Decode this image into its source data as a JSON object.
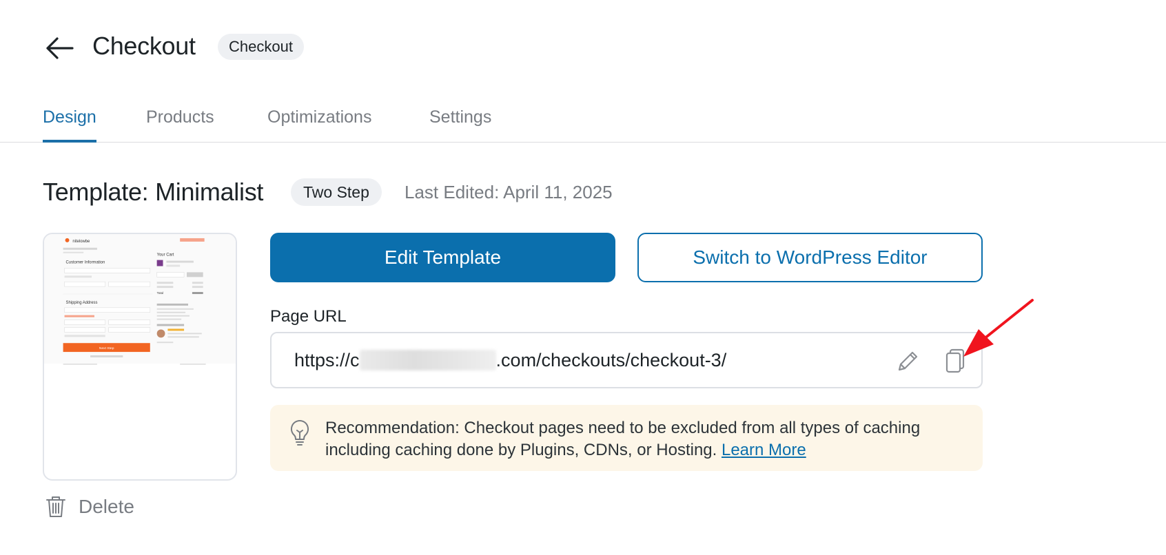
{
  "header": {
    "title": "Checkout",
    "badge": "Checkout"
  },
  "tabs": [
    {
      "label": "Design",
      "active": true
    },
    {
      "label": "Products",
      "active": false
    },
    {
      "label": "Optimizations",
      "active": false
    },
    {
      "label": "Settings",
      "active": false
    }
  ],
  "template": {
    "title": "Template: Minimalist",
    "step_badge": "Two Step",
    "last_edited": "Last Edited: April 11, 2025"
  },
  "actions": {
    "edit_template": "Edit Template",
    "switch_editor": "Switch to WordPress Editor",
    "delete": "Delete"
  },
  "page_url": {
    "label": "Page URL",
    "prefix": "https://c",
    "suffix": ".com/checkouts/checkout-3/"
  },
  "recommendation": {
    "text": "Recommendation: Checkout pages need to be excluded from all types of caching including caching done by Plugins, CDNs, or Hosting.",
    "link": "Learn More"
  },
  "thumbnail": {
    "brand": "nitelowbe",
    "customer_info": "Customer Information",
    "your_cart": "Your Cart",
    "shipping_address": "Shipping Address",
    "next_step": "Next Step",
    "total": "Total"
  },
  "colors": {
    "primary": "#0b6fad",
    "tab_active": "#1b6fa8",
    "muted_text": "#787c82",
    "recommendation_bg": "#fdf6e8",
    "annotation_red": "#f0141e",
    "thumbnail_cta": "#f26522"
  },
  "icons": {
    "back": "arrow-left-icon",
    "trash": "trash-icon",
    "pencil": "pencil-icon",
    "copy": "copy-icon",
    "lightbulb": "lightbulb-icon"
  }
}
